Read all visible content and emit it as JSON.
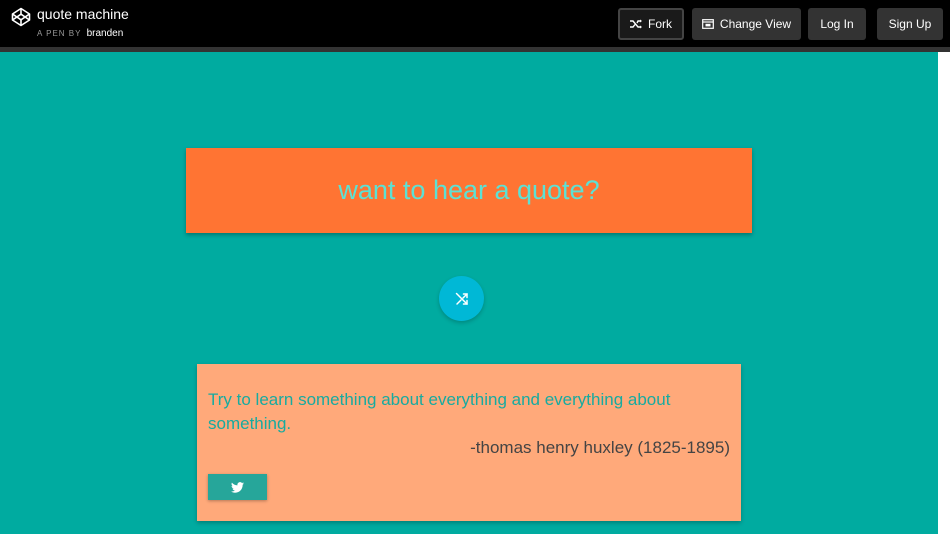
{
  "header": {
    "pen_title": "quote machine",
    "byline_prefix": "A PEN BY",
    "author": "branden",
    "buttons": {
      "fork": "Fork",
      "change_view": "Change View",
      "login": "Log In",
      "signup": "Sign Up"
    }
  },
  "app": {
    "title": "want to hear a quote?",
    "quote": {
      "text": "Try to learn something about everything and everything about something.",
      "author": "-thomas henry huxley (1825-1895)"
    },
    "icons": {
      "shuffle": "shuffle-icon",
      "tweet": "twitter-icon"
    }
  },
  "colors": {
    "background": "#00aba0",
    "header_card": "#ff7433",
    "header_text": "#5ce1d4",
    "quote_card": "#ffa97a",
    "quote_text": "#17aba0",
    "shuffle_button": "#00b8d6",
    "tweet_button": "#26a69a"
  }
}
